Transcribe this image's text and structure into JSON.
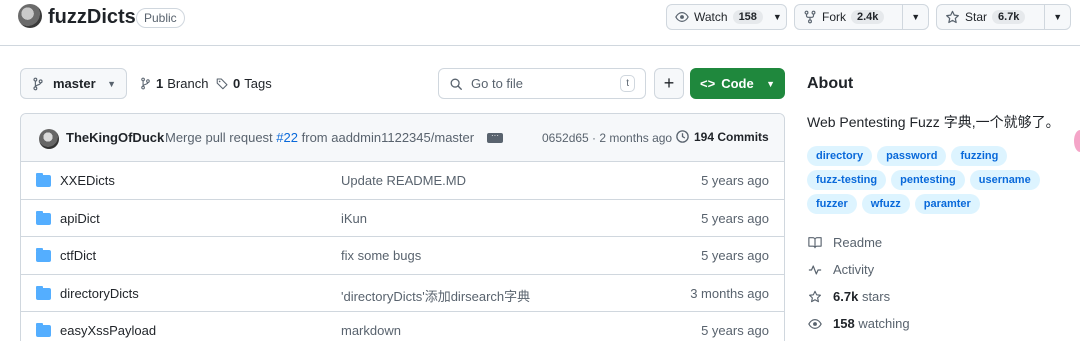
{
  "repo": {
    "name": "fuzzDicts",
    "visibility": "Public"
  },
  "actions": {
    "watch_label": "Watch",
    "watch_count": "158",
    "fork_label": "Fork",
    "fork_count": "2.4k",
    "star_label": "Star",
    "star_count": "6.7k"
  },
  "toolbar": {
    "branch": "master",
    "branches_count": "1",
    "branches_label": "Branch",
    "tags_count": "0",
    "tags_label": "Tags",
    "goto_placeholder": "Go to file",
    "goto_key": "t",
    "add_label": "+",
    "code_label": "Code"
  },
  "commit": {
    "author": "TheKingOfDuck",
    "message_prefix": "Merge pull request",
    "pr": "#22",
    "message_suffix": "from aaddmin1122345/master",
    "hash_time": "0652d65 · 2 months ago",
    "commits_count": "194 Commits"
  },
  "files": [
    {
      "name": "XXEDicts",
      "message": "Update README.MD",
      "date": "5 years ago"
    },
    {
      "name": "apiDict",
      "message": "iKun",
      "date": "5 years ago"
    },
    {
      "name": "ctfDict",
      "message": "fix some bugs",
      "date": "5 years ago"
    },
    {
      "name": "directoryDicts",
      "message": "'directoryDicts'添加dirsearch字典",
      "date": "3 months ago"
    },
    {
      "name": "easyXssPayload",
      "message": "markdown",
      "date": "5 years ago"
    }
  ],
  "about": {
    "title": "About",
    "description": "Web Pentesting Fuzz 字典,一个就够了。",
    "topics": [
      "directory",
      "password",
      "fuzzing",
      "fuzz-testing",
      "pentesting",
      "username",
      "fuzzer",
      "wfuzz",
      "paramter"
    ],
    "readme": "Readme",
    "activity": "Activity",
    "stars_count": "6.7k",
    "stars_label": "stars",
    "watching_count": "158",
    "watching_label": "watching"
  },
  "colors": {
    "accent": "#0969da",
    "code_button": "#1f883d",
    "topic_bg": "#ddf4ff",
    "folder": "#54aeff"
  },
  "icons": [
    "repo-owner-avatar",
    "eye-icon",
    "fork-icon",
    "star-icon",
    "branch-icon",
    "tag-icon",
    "search-icon",
    "code-icon",
    "history-icon",
    "folder-icon",
    "book-icon",
    "pulse-icon"
  ]
}
